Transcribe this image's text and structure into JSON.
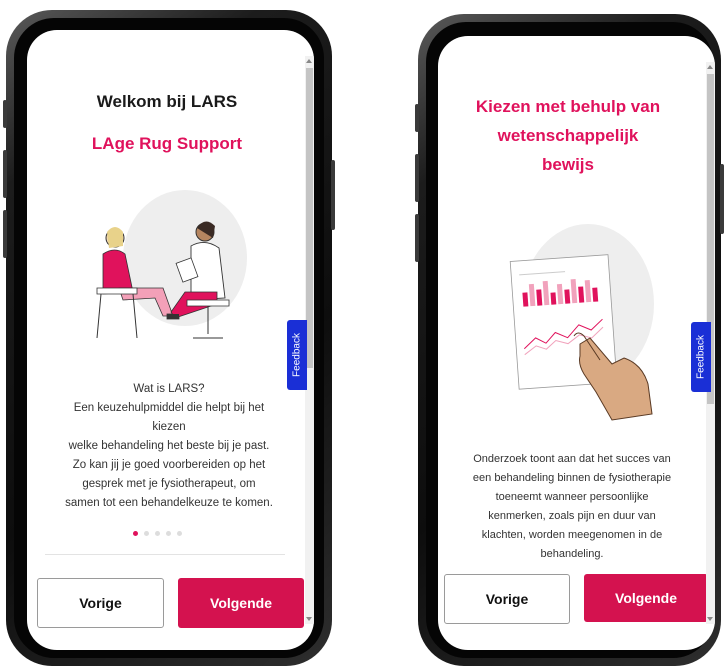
{
  "colors": {
    "accent": "#e0125c",
    "button_primary": "#d4124f",
    "feedback_tab": "#1a2fd6"
  },
  "phone_left": {
    "title": "Welkom bij LARS",
    "subtitle": "LAge Rug Support",
    "illustration_icon": "consultation-illustration",
    "body_lines": [
      "Wat is LARS?",
      "Een keuzehulpmiddel die helpt bij het",
      "kiezen",
      "welke behandeling het beste bij je past.",
      "Zo kan jij je goed voorbereiden op het",
      "gesprek met je fysiotherapeut, om",
      "samen tot een behandelkeuze te komen."
    ],
    "pagination": {
      "total": 5,
      "active": 1
    },
    "feedback_label": "Feedback",
    "prev_label": "Vorige",
    "next_label": "Volgende"
  },
  "phone_right": {
    "title_lines": [
      "Kiezen met behulp van",
      "wetenschappelijk",
      "bewijs"
    ],
    "illustration_icon": "chart-touch-illustration",
    "body_lines": [
      "Onderzoek toont aan dat het succes van",
      "een behandeling binnen de fysiotherapie",
      "toeneemt wanneer persoonlijke",
      "kenmerken, zoals pijn en duur van",
      "klachten, worden meegenomen in de",
      "behandeling."
    ],
    "feedback_label": "Feedback",
    "prev_label": "Vorige",
    "next_label": "Volgende"
  }
}
